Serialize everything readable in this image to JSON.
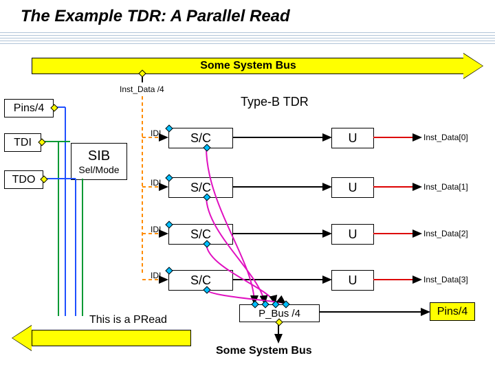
{
  "title": "The Example TDR: A Parallel Read",
  "top_bus": "Some System Bus",
  "bottom_bus": "Some System Bus",
  "pins_left": "Pins/4",
  "tdi": "TDI",
  "tdo": "TDO",
  "sib": "SIB",
  "sel_mode": "Sel/Mode",
  "inst_data_bus": "Inst_Data /4",
  "type": "Type-B TDR",
  "idi": "IDI",
  "sc": "S/C",
  "u": "U",
  "inst_rows": [
    "Inst_Data[0]",
    "Inst_Data[1]",
    "Inst_Data[2]",
    "Inst_Data[3]"
  ],
  "pbus": "P_Bus /4",
  "pins_right": "Pins/4",
  "pread": "This is a PRead"
}
